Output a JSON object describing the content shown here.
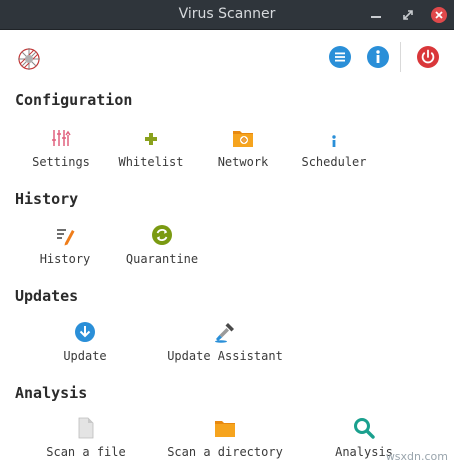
{
  "window": {
    "title": "Virus Scanner",
    "minimize_icon": "minimize-icon",
    "maximize_icon": "maximize-icon",
    "close_icon": "close-icon"
  },
  "toolbar": {
    "logo_icon": "virus-scanner-logo",
    "menu_icon": "menu-icon",
    "about_icon": "info-icon",
    "power_icon": "power-icon",
    "accent_blue": "#2a8fd8",
    "accent_red": "#d9373a"
  },
  "sections": {
    "configuration": {
      "title": "Configuration",
      "items": [
        {
          "label": "Settings",
          "icon": "settings-sliders-icon"
        },
        {
          "label": "Whitelist",
          "icon": "plus-icon"
        },
        {
          "label": "Network",
          "icon": "network-folder-icon"
        },
        {
          "label": "Scheduler",
          "icon": "info-dot-icon"
        }
      ]
    },
    "history": {
      "title": "History",
      "items": [
        {
          "label": "History",
          "icon": "history-list-icon"
        },
        {
          "label": "Quarantine",
          "icon": "quarantine-refresh-icon"
        }
      ]
    },
    "updates": {
      "title": "Updates",
      "items": [
        {
          "label": "Update",
          "icon": "download-icon"
        },
        {
          "label": "Update Assistant",
          "icon": "dropper-icon"
        }
      ]
    },
    "analysis": {
      "title": "Analysis",
      "items": [
        {
          "label": "Scan a file",
          "icon": "file-icon"
        },
        {
          "label": "Scan a directory",
          "icon": "folder-icon"
        },
        {
          "label": "Analysis",
          "icon": "magnifier-icon"
        }
      ]
    }
  },
  "watermark": "wsxdn.com"
}
